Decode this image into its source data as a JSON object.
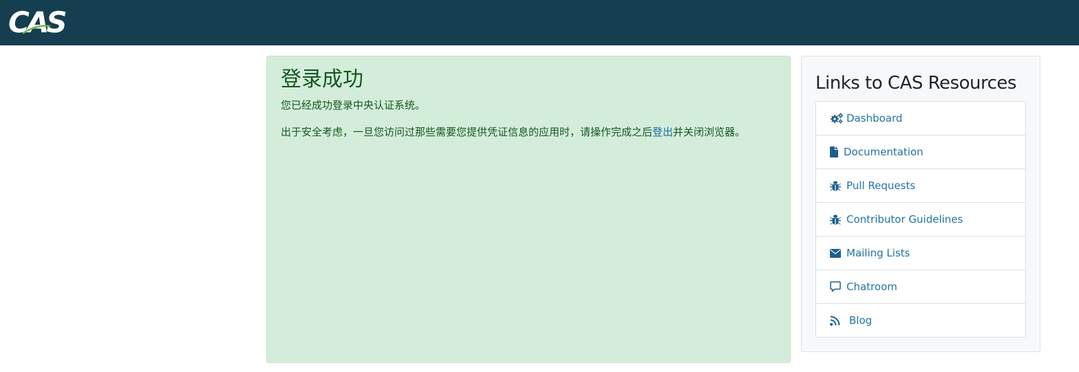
{
  "header": {
    "logo_text": "CAS",
    "colors": {
      "bar": "#153e50",
      "logo_swoosh": "#6fb83f"
    }
  },
  "success": {
    "title": "登录成功",
    "message": "您已经成功登录中央认证系统。",
    "security_prefix": "出于安全考虑，一旦您访问过那些需要您提供凭证信息的应用时，请操作完成之后",
    "logout_link": "登出",
    "security_suffix": "并关闭浏览器。",
    "colors": {
      "background": "#d4edda",
      "text": "#155724"
    }
  },
  "resources": {
    "title": "Links to CAS Resources",
    "links": [
      {
        "label": "Dashboard",
        "icon": "cogs-icon"
      },
      {
        "label": "Documentation",
        "icon": "file-icon"
      },
      {
        "label": "Pull Requests",
        "icon": "bug-icon"
      },
      {
        "label": "Contributor Guidelines",
        "icon": "bug-icon"
      },
      {
        "label": "Mailing Lists",
        "icon": "envelope-icon"
      },
      {
        "label": "Chatroom",
        "icon": "comment-icon"
      },
      {
        "label": "Blog",
        "icon": "rss-icon"
      }
    ],
    "colors": {
      "link": "#2273a6",
      "icon": "#1d5f8c"
    }
  }
}
